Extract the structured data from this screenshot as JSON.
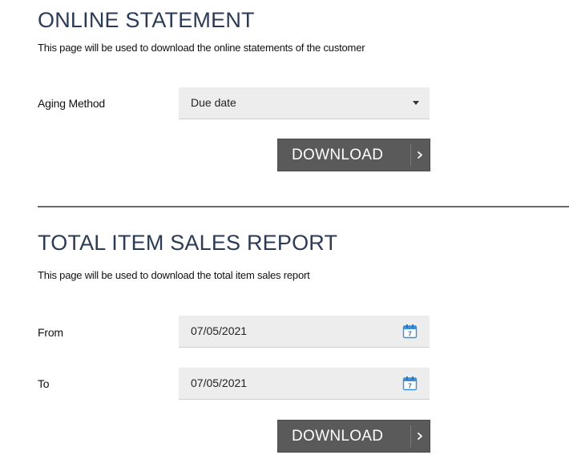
{
  "online_statement": {
    "title": "ONLINE STATEMENT",
    "description": "This page will be used to download the online statements of the customer",
    "aging_method": {
      "label": "Aging Method",
      "value": "Due date"
    },
    "download_label": "DOWNLOAD",
    "download_arrow": "›"
  },
  "total_item_sales": {
    "title": "TOTAL ITEM SALES REPORT",
    "description": "This page will be used to download the total item sales report",
    "from": {
      "label": "From",
      "value": "07/05/2021"
    },
    "to": {
      "label": "To",
      "value": "07/05/2021"
    },
    "calendar_day": "7",
    "download_label": "DOWNLOAD",
    "download_arrow": "›"
  },
  "colors": {
    "title": "#2b3a55",
    "button": "#5a5a5a",
    "field": "#ededed",
    "calendar_icon": "#3a8fd6"
  },
  "icons": {
    "select_caret": "chevron-down-icon",
    "date_picker": "calendar-icon",
    "button_arrow": "chevron-right-icon"
  }
}
